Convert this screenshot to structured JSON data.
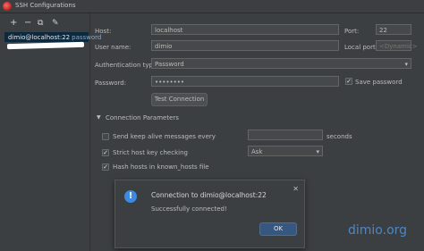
{
  "window": {
    "title": "SSH Configurations"
  },
  "toolbar": {
    "add": "+",
    "remove": "−",
    "copy": "⧉",
    "edit": "✎"
  },
  "sidebar": {
    "items": [
      {
        "label": "dimio@localhost:22",
        "sub": "password"
      }
    ]
  },
  "form": {
    "host_label": "Host:",
    "host_value": "localhost",
    "port_label": "Port:",
    "port_value": "22",
    "user_label": "User name:",
    "user_value": "dimio",
    "local_port_label": "Local port:",
    "local_port_value": "<Dynamic>",
    "auth_label": "Authentication type:",
    "auth_value": "Password",
    "password_label": "Password:",
    "password_value": "••••••••",
    "save_password_label": "Save password",
    "save_password_checked": true,
    "test_button": "Test Connection"
  },
  "params": {
    "section_title": "Connection Parameters",
    "keep_alive_label": "Send keep alive messages every",
    "keep_alive_value": "",
    "keep_alive_unit": "seconds",
    "strict_label": "Strict host key checking",
    "strict_value": "Ask",
    "hash_label": "Hash hosts in known_hosts file"
  },
  "dialog": {
    "title": "Connection to dimio@localhost:22",
    "message": "Successfully connected!",
    "ok": "OK",
    "close": "✕",
    "icon": "!"
  },
  "watermark": "dimio.org",
  "colors": {
    "accent": "#365880",
    "selection": "#0d293e",
    "info_icon": "#3d8be0"
  }
}
